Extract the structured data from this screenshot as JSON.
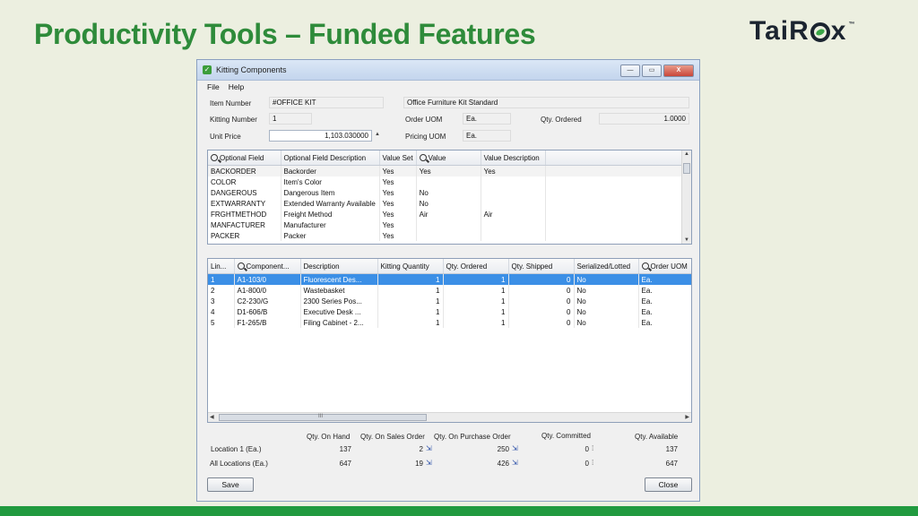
{
  "slide": {
    "title": "Productivity Tools – Funded Features",
    "logo": "TaiRox",
    "logo_pre": "TaiR",
    "logo_post": "x",
    "logo_tm": "™"
  },
  "window": {
    "title": "Kitting Components",
    "menu": [
      "File",
      "Help"
    ],
    "controls": {
      "minimize": "—",
      "maximize": "▭",
      "close": "X"
    }
  },
  "header": {
    "item_number_label": "Item Number",
    "item_number": "#OFFICE KIT",
    "item_description": "Office Furniture Kit Standard",
    "kitting_number_label": "Kitting Number",
    "kitting_number": "1",
    "order_uom_label": "Order UOM",
    "order_uom": "Ea.",
    "qty_ordered_label": "Qty. Ordered",
    "qty_ordered": "1.0000",
    "unit_price_label": "Unit Price",
    "unit_price": "1,103.030000",
    "pricing_uom_label": "Pricing UOM",
    "pricing_uom": "Ea."
  },
  "optional_fields": {
    "columns": [
      "Optional Field",
      "Optional Field Description",
      "Value Set",
      "Value",
      "Value Description"
    ],
    "rows": [
      [
        "BACKORDER",
        "Backorder",
        "Yes",
        "Yes",
        "Yes"
      ],
      [
        "COLOR",
        "Item's Color",
        "Yes",
        "",
        ""
      ],
      [
        "DANGEROUS",
        "Dangerous Item",
        "Yes",
        "No",
        ""
      ],
      [
        "EXTWARRANTY",
        "Extended Warranty Available",
        "Yes",
        "No",
        ""
      ],
      [
        "FRGHTMETHOD",
        "Freight Method",
        "Yes",
        "Air",
        "Air"
      ],
      [
        "MANFACTURER",
        "Manufacturer",
        "Yes",
        "",
        ""
      ],
      [
        "PACKER",
        "Packer",
        "Yes",
        "",
        ""
      ]
    ]
  },
  "components": {
    "columns": [
      "Lin...",
      "Component...",
      "Description",
      "Kitting Quantity",
      "Qty. Ordered",
      "Qty. Shipped",
      "Serialized/Lotted",
      "Order UOM"
    ],
    "rows": [
      [
        "1",
        "A1-103/0",
        "Fluorescent Des...",
        "1",
        "1",
        "0",
        "No",
        "Ea."
      ],
      [
        "2",
        "A1-800/0",
        "Wastebasket",
        "1",
        "1",
        "0",
        "No",
        "Ea."
      ],
      [
        "3",
        "C2-230/G",
        "2300 Series Pos...",
        "1",
        "1",
        "0",
        "No",
        "Ea."
      ],
      [
        "4",
        "D1-606/B",
        "Executive Desk ...",
        "1",
        "1",
        "0",
        "No",
        "Ea."
      ],
      [
        "5",
        "F1-265/B",
        "Filing Cabinet - 2...",
        "1",
        "1",
        "0",
        "No",
        "Ea."
      ]
    ],
    "scroll_grip": "III"
  },
  "totals": {
    "columns": [
      "Qty. On Hand",
      "Qty. On Sales Order",
      "Qty. On Purchase Order",
      "Qty. Committed",
      "Qty. Available"
    ],
    "location_label": "Location 1 (Ea.)",
    "location": [
      "137",
      "2",
      "250",
      "0",
      "137"
    ],
    "all_label": "All Locations (Ea.)",
    "all": [
      "647",
      "19",
      "426",
      "0",
      "647"
    ]
  },
  "buttons": {
    "save": "Save",
    "close": "Close"
  }
}
